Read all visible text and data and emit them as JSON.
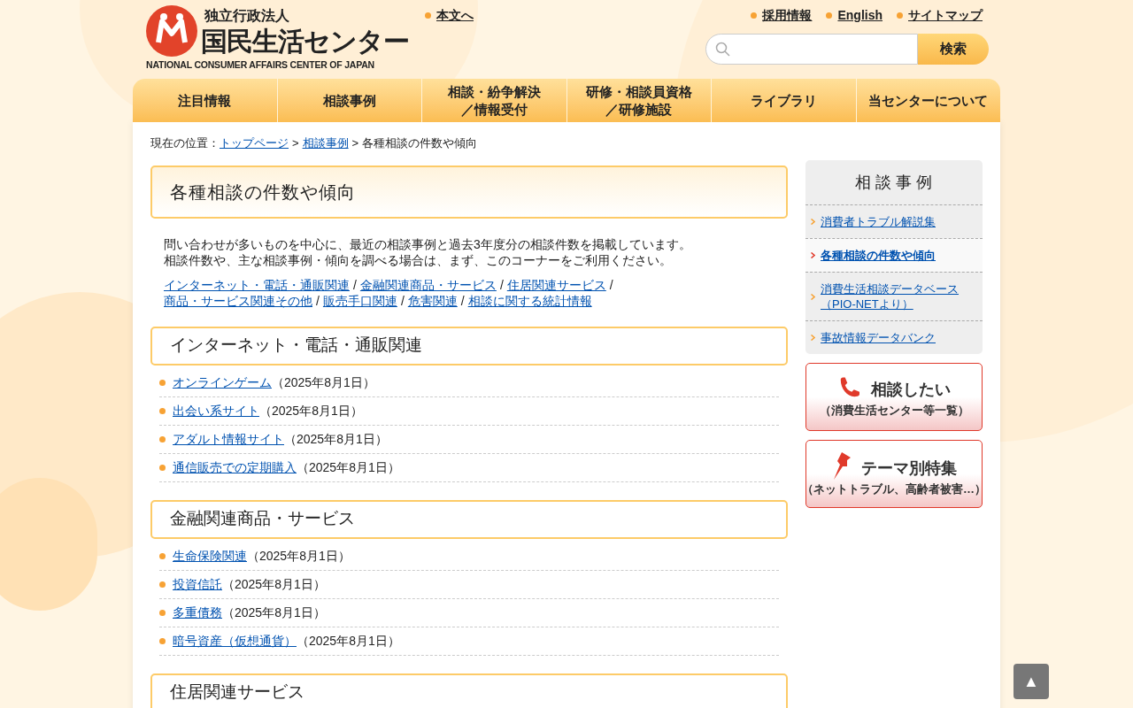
{
  "logo": {
    "org_type": "独立行政法人",
    "name": "国民生活センター",
    "english": "NATIONAL CONSUMER AFFAIRS CENTER OF JAPAN"
  },
  "skip_link": "本文へ",
  "header_links": [
    "採用情報",
    "English",
    "サイトマップ"
  ],
  "search": {
    "button": "検索"
  },
  "nav": [
    {
      "lines": [
        "注目情報"
      ]
    },
    {
      "lines": [
        "相談事例"
      ]
    },
    {
      "lines": [
        "相談・紛争解決",
        "／情報受付"
      ]
    },
    {
      "lines": [
        "研修・相談員資格",
        "／研修施設"
      ]
    },
    {
      "lines": [
        "ライブラリ"
      ]
    },
    {
      "lines": [
        "当センターについて"
      ]
    }
  ],
  "breadcrumb": {
    "label": "現在の位置：",
    "links": [
      "トップページ",
      "相談事例"
    ],
    "separators": [
      ">",
      ">"
    ],
    "current": "各種相談の件数や傾向"
  },
  "page_title": "各種相談の件数や傾向",
  "intro": [
    "問い合わせが多いものを中心に、最近の相談事例と過去3年度分の相談件数を掲載しています。",
    "相談件数や、主な相談事例・傾向を調べる場合は、まず、このコーナーをご利用ください。"
  ],
  "anchor_links": [
    "インターネット・電話・通販関連",
    "金融関連商品・サービス",
    "住居関連サービス",
    "商品・サービス関連その他",
    "販売手口関連",
    "危害関連",
    "相談に関する統計情報"
  ],
  "anchor_separators": [
    "/",
    "/",
    "/",
    "/",
    "/",
    "/"
  ],
  "sections": [
    {
      "heading": "インターネット・電話・通販関連",
      "items": [
        {
          "link": "オンラインゲーム",
          "date": "（2025年8月1日）"
        },
        {
          "link": "出会い系サイト",
          "date": "（2025年8月1日）"
        },
        {
          "link": "アダルト情報サイト",
          "date": "（2025年8月1日）"
        },
        {
          "link": "通信販売での定期購入",
          "date": "（2025年8月1日）"
        }
      ]
    },
    {
      "heading": "金融関連商品・サービス",
      "items": [
        {
          "link": "生命保険関連",
          "date": "（2025年8月1日）"
        },
        {
          "link": "投資信託",
          "date": "（2025年8月1日）"
        },
        {
          "link": "多重債務",
          "date": "（2025年8月1日）"
        },
        {
          "link": "暗号資産（仮想通貨）",
          "date": "（2025年8月1日）"
        }
      ]
    },
    {
      "heading": "住居関連サービス"
    }
  ],
  "sidebar": {
    "title": "相 談 事 例",
    "items": [
      {
        "label": "消費者トラブル解説集",
        "selected": false
      },
      {
        "label": "各種相談の件数や傾向",
        "selected": true
      },
      {
        "label": "消費生活相談データベース（PIO-NETより）",
        "selected": false
      },
      {
        "label": "事故情報データバンク",
        "selected": false
      }
    ]
  },
  "banners": [
    {
      "kind": "phone",
      "title": "相談したい",
      "subtitle": "（消費生活センター等一覧）"
    },
    {
      "kind": "pin",
      "title": "テーマ別特集",
      "subtitle": "（ネットトラブル、高齢者被害…）"
    }
  ],
  "back_to_top": "▲"
}
